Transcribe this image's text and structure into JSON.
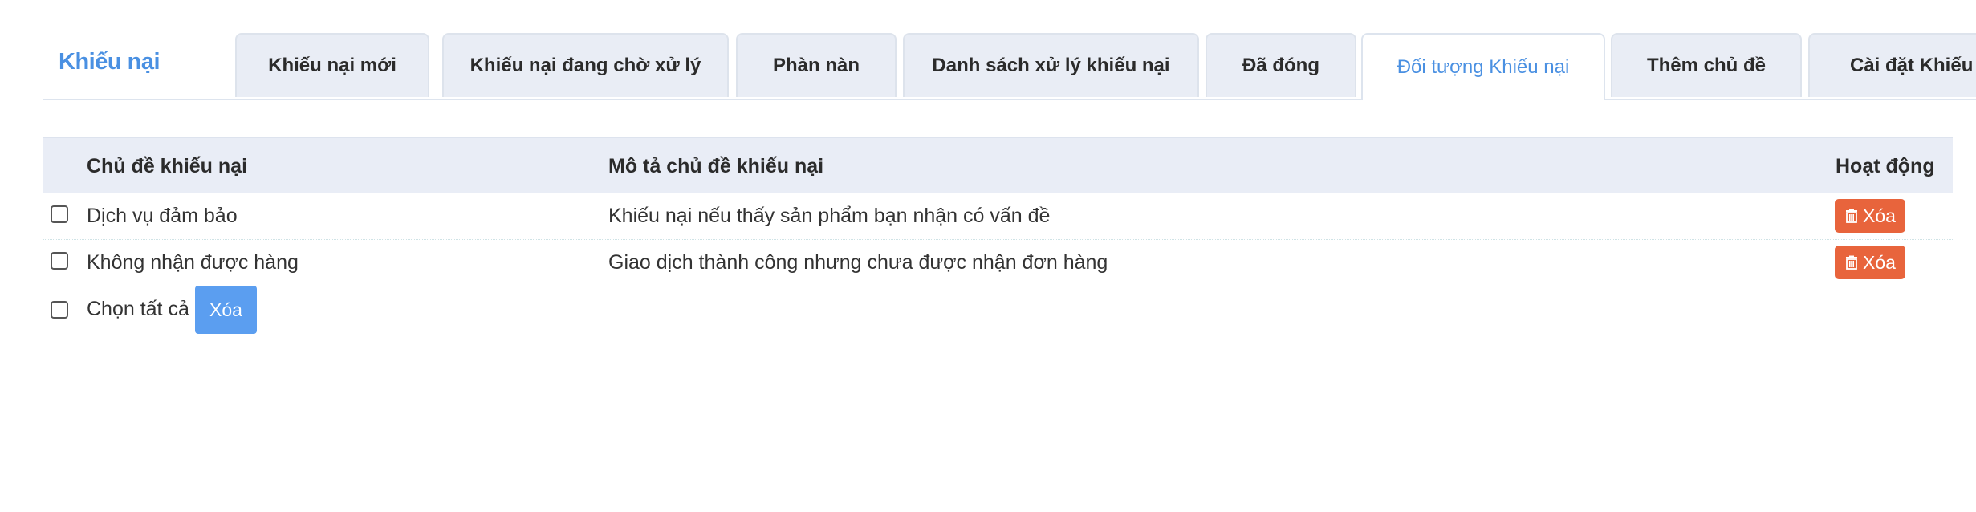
{
  "brand": {
    "title": "Khiếu nại"
  },
  "tabs": [
    {
      "label": "Khiếu nại mới",
      "active": false
    },
    {
      "label": "Khiếu nại đang chờ xử lý",
      "active": false
    },
    {
      "label": "Phàn nàn",
      "active": false
    },
    {
      "label": "Danh sách xử lý khiếu nại",
      "active": false
    },
    {
      "label": "Đã đóng",
      "active": false
    },
    {
      "label": "Đối tượng Khiếu nại",
      "active": true
    },
    {
      "label": "Thêm chủ đề",
      "active": false
    },
    {
      "label": "Cài đặt Khiếu nại",
      "active": false
    }
  ],
  "table": {
    "headers": {
      "topic": "Chủ đề khiếu nại",
      "description": "Mô tả chủ đề khiếu nại",
      "actions": "Hoạt động"
    },
    "rows": [
      {
        "topic": "Dịch vụ đảm bảo",
        "description": "Khiếu nại nếu thấy sản phẩm bạn nhận có vấn đề",
        "delete_label": "Xóa",
        "checked": false
      },
      {
        "topic": "Không nhận được hàng",
        "description": "Giao dịch thành công nhưng chưa được nhận đơn hàng",
        "delete_label": "Xóa",
        "checked": false
      }
    ]
  },
  "footer": {
    "select_all_label": "Chọn tất cả",
    "bulk_delete_label": "Xóa"
  },
  "colors": {
    "accent": "#4a90e2",
    "danger": "#e8643c",
    "primary_button": "#5b9ef0",
    "header_bg": "#e9edf6"
  },
  "icons": {
    "row_delete": "trash-icon"
  }
}
